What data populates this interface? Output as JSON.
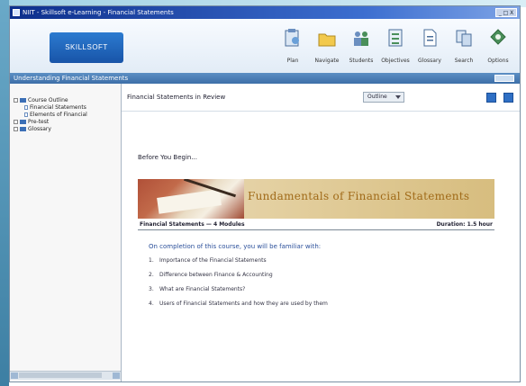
{
  "window": {
    "title": "NIIT - Skillsoft e-Learning - Financial Statements",
    "controls": "_ □ X"
  },
  "header": {
    "logo_text": "SKILLSOFT",
    "toolbar": [
      {
        "label": "Plan",
        "icon": "plan-icon"
      },
      {
        "label": "Navigate",
        "icon": "folder-icon"
      },
      {
        "label": "Students",
        "icon": "people-icon"
      },
      {
        "label": "Objectives",
        "icon": "list-icon"
      },
      {
        "label": "Glossary",
        "icon": "document-icon"
      },
      {
        "label": "Search",
        "icon": "search-icon"
      },
      {
        "label": "Options",
        "icon": "gear-icon"
      }
    ]
  },
  "breadcrumb": {
    "text": "Understanding Financial Statements",
    "exit_label": ""
  },
  "sidebar": {
    "root_label": "",
    "items": [
      {
        "label": "Course Outline",
        "level": 1
      },
      {
        "label": "Financial Statements",
        "level": 2
      },
      {
        "label": "Elements of Financial",
        "level": 2
      },
      {
        "label": "Pre-test",
        "level": 1
      },
      {
        "label": "Glossary",
        "level": 1
      }
    ]
  },
  "content": {
    "title": "Financial Statements in Review",
    "select_value": "Outline",
    "intro": "Before You Begin...",
    "banner_title": "Fundamentals of Financial Statements",
    "info_left": "Financial Statements — 4 Modules",
    "info_right": "Duration: 1.5 hour",
    "objective_heading": "On completion of this course, you will be familiar with:",
    "objectives": [
      {
        "num": "1.",
        "text": "Importance of the Financial Statements"
      },
      {
        "num": "2.",
        "text": "Difference between Finance & Accounting"
      },
      {
        "num": "3.",
        "text": "What are Financial Statements?"
      },
      {
        "num": "4.",
        "text": "Users of Financial Statements and how they are used by them"
      }
    ]
  },
  "colors": {
    "titlebar": "#0d2f8c",
    "breadcrumb_bar": "#4a7db6",
    "accent_text": "#2a4f9a",
    "banner_title": "#a06a18"
  }
}
